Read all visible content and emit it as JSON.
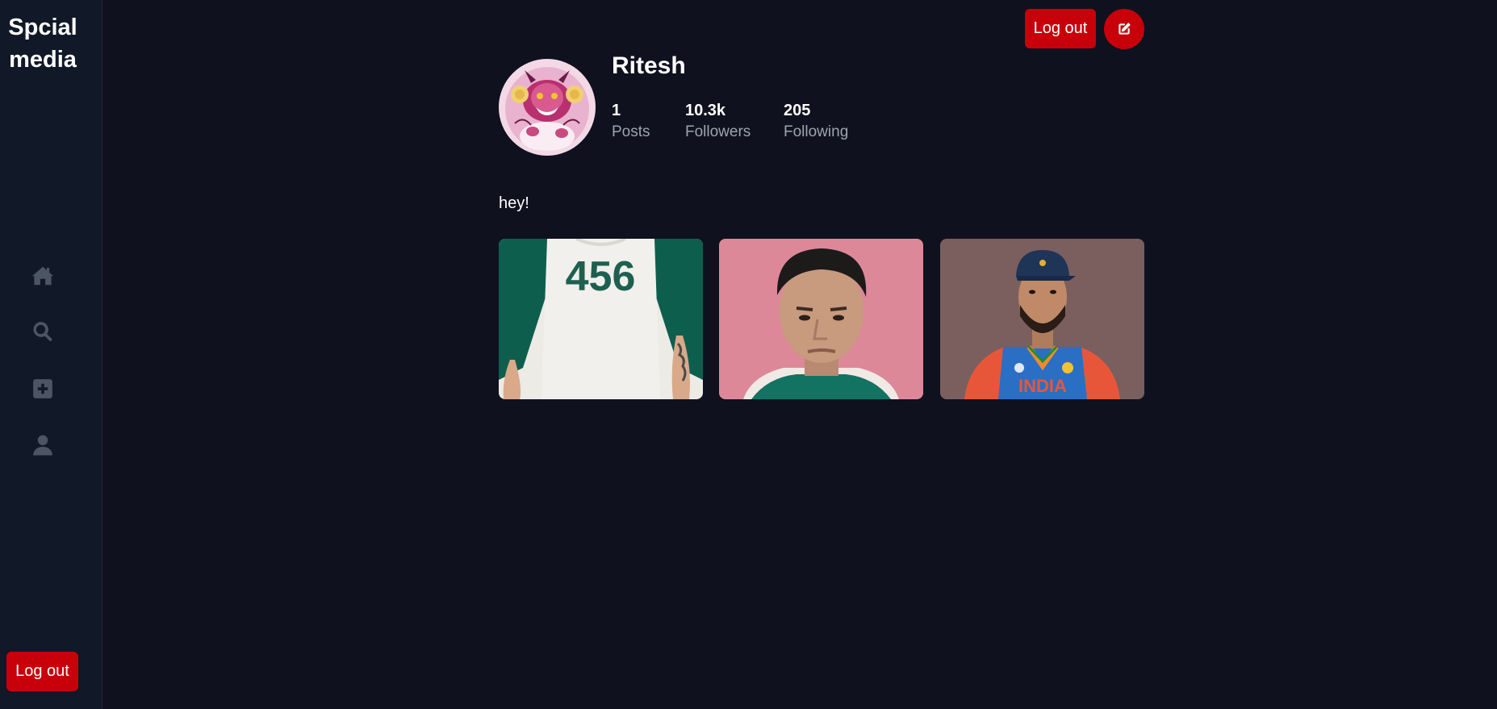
{
  "app": {
    "brand": "Spcial media"
  },
  "sidebar": {
    "nav": [
      {
        "icon": "home-icon"
      },
      {
        "icon": "search-icon"
      },
      {
        "icon": "plus-square-icon"
      },
      {
        "icon": "user-icon"
      }
    ],
    "logout_label": "Log out"
  },
  "header": {
    "logout_label": "Log out",
    "edit_icon": "edit-icon"
  },
  "profile": {
    "username": "Ritesh",
    "stats": {
      "posts": {
        "value": "1",
        "label": "Posts"
      },
      "followers": {
        "value": "10.3k",
        "label": "Followers"
      },
      "following": {
        "value": "205",
        "label": "Following"
      }
    },
    "bio": "hey!",
    "posts_grid": [
      {
        "jersey_number": "456"
      },
      {},
      {
        "jersey_text": "INDIA"
      }
    ]
  },
  "colors": {
    "background": "#10111f",
    "sidebar": "#111827",
    "accent_red": "#c8000a",
    "icon_gray": "#4b5563",
    "muted_text": "#9ca3af"
  }
}
